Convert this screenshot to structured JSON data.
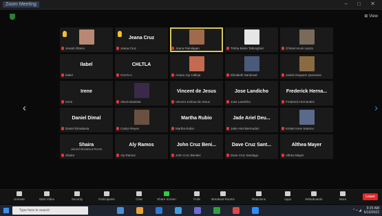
{
  "window": {
    "title": "Zoom Meeting",
    "view_link": "⊞ View",
    "window_buttons": "– □ ✕"
  },
  "nav": {
    "prev": "‹",
    "next": "›"
  },
  "tiles": [
    {
      "name": "",
      "label": "Jenarti Olamo",
      "hand": true,
      "cam": "#b98872"
    },
    {
      "name": "Jeana Cruz",
      "label": "Jeana Cruz",
      "hand": true,
      "cam": ""
    },
    {
      "name": "",
      "label": "Jeana Pamilagan",
      "active": true,
      "cam": "#a06a4c"
    },
    {
      "name": "",
      "label": "Trisha Marie Tatlonghari",
      "cam": "#e6e6e6"
    },
    {
      "name": "",
      "label": "Chrisel Acuin Lanza",
      "cam": "#7a6a5a"
    },
    {
      "name": "Ilabel",
      "label": "Ilabel",
      "cam": ""
    },
    {
      "name": "CHLTLA",
      "label": "CHLTLA",
      "cam": ""
    },
    {
      "name": "",
      "label": "Ariana Joy Calleja",
      "cam": "#c46a50"
    },
    {
      "name": "",
      "label": "Elizabeth Sandoval",
      "cam": "#4a5a7a"
    },
    {
      "name": "",
      "label": "Jaimie Duquem Quinones",
      "cam": "#8a6a40"
    },
    {
      "name": "Irene",
      "label": "Irene",
      "cam": ""
    },
    {
      "name": "",
      "label": "Alexis Bautista",
      "cam": "#3a2a4a"
    },
    {
      "name": "Vincent de Jesus",
      "label": "Vincent Joshua de Jesus",
      "cam": ""
    },
    {
      "name": "Jose Landicho",
      "label": "Jose Landicho",
      "cam": ""
    },
    {
      "name": "Frederick Herna...",
      "label": "Frederick Hernandez",
      "cam": ""
    },
    {
      "name": "Daniel Dimal",
      "label": "Daniel Dimalanta",
      "cam": ""
    },
    {
      "name": "",
      "label": "Carlyn Reyes",
      "cam": "#6a5040"
    },
    {
      "name": "Martha Rubio",
      "label": "Martha Rubio",
      "cam": ""
    },
    {
      "name": "Jade Ariel Deu...",
      "label": "Jade Ariel Bermudez",
      "cam": ""
    },
    {
      "name": "",
      "label": "Kristel Anne Saturno",
      "cam": "#5a6a8a"
    },
    {
      "name": "Shaira",
      "label": "Shaira",
      "sub": "Joined Breakout Room",
      "cam": ""
    },
    {
      "name": "Aly Ramos",
      "label": "Aly Ramos",
      "cam": ""
    },
    {
      "name": "John Cruz Beni...",
      "label": "John Cruz Benitez",
      "cam": ""
    },
    {
      "name": "Dave Cruz Sant...",
      "label": "Dave Cruz Santiago",
      "cam": ""
    },
    {
      "name": "Althea Mayer",
      "label": "Althea Mayer",
      "cam": ""
    }
  ],
  "toolbar": [
    {
      "label": "Unmute",
      "green": false
    },
    {
      "label": "Start Video",
      "green": false
    },
    {
      "label": "Security",
      "green": false
    },
    {
      "label": "Participants",
      "green": false
    },
    {
      "label": "Chat",
      "green": false
    },
    {
      "label": "Share Screen",
      "green": true
    },
    {
      "label": "Polls",
      "green": false
    },
    {
      "label": "Breakout Rooms",
      "green": false
    },
    {
      "label": "Reactions",
      "green": false
    },
    {
      "label": "Apps",
      "green": false
    },
    {
      "label": "Whiteboards",
      "green": false
    },
    {
      "label": "More",
      "green": false
    }
  ],
  "leave_label": "Leave",
  "taskbar": {
    "search_placeholder": "Type here to search",
    "apps": [
      "#4a90d9",
      "#e5a43a",
      "#2d7ad6",
      "#3aa0e0",
      "#6b6bd6",
      "#2ea043",
      "#d94a4a",
      "#2d8cff"
    ],
    "tray": "^ ⌁ ◢",
    "time": "9:25 AM",
    "date": "6/10/2022"
  },
  "colors": {
    "hand": "#f5c02a",
    "muted": "#e53935",
    "active_border": "#d9c65a",
    "leave": "#e02828",
    "accent": "#2f7fff"
  }
}
